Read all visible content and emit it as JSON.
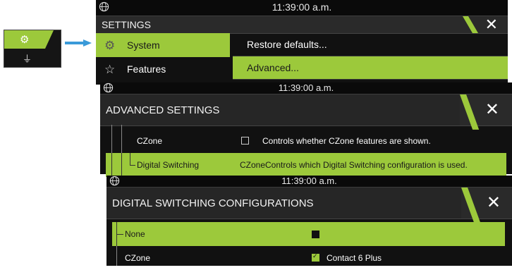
{
  "mini_strip": {
    "gear_icon": "gear-icon",
    "plug_icon": "plug-icon"
  },
  "accent": "#9cc93b",
  "panel1": {
    "time": "11:39:00 a.m.",
    "title": "SETTINGS",
    "menu": [
      {
        "label": "System",
        "icon": "gear-icon",
        "selected": true
      },
      {
        "label": "Features",
        "icon": "star-icon",
        "selected": false
      }
    ],
    "submenu": [
      {
        "label": "Restore defaults...",
        "selected": false
      },
      {
        "label": "Advanced...",
        "selected": true
      }
    ]
  },
  "panel2": {
    "time": "11:39:00 a.m.",
    "title": "ADVANCED SETTINGS",
    "rows": [
      {
        "name": "CZone",
        "value": "",
        "description": "Controls whether CZone features are shown.",
        "selected": false
      },
      {
        "name": "Digital Switching",
        "value": "CZone",
        "description": "Controls which Digital Switching configuration is used.",
        "selected": true
      }
    ]
  },
  "panel3": {
    "time": "11:39:00 a.m.",
    "title": "DIGITAL SWITCHING CONFIGURATIONS",
    "rows": [
      {
        "name": "None",
        "value": "",
        "selected": true
      },
      {
        "name": "CZone",
        "value": "Contact 6 Plus",
        "selected": false
      }
    ]
  }
}
